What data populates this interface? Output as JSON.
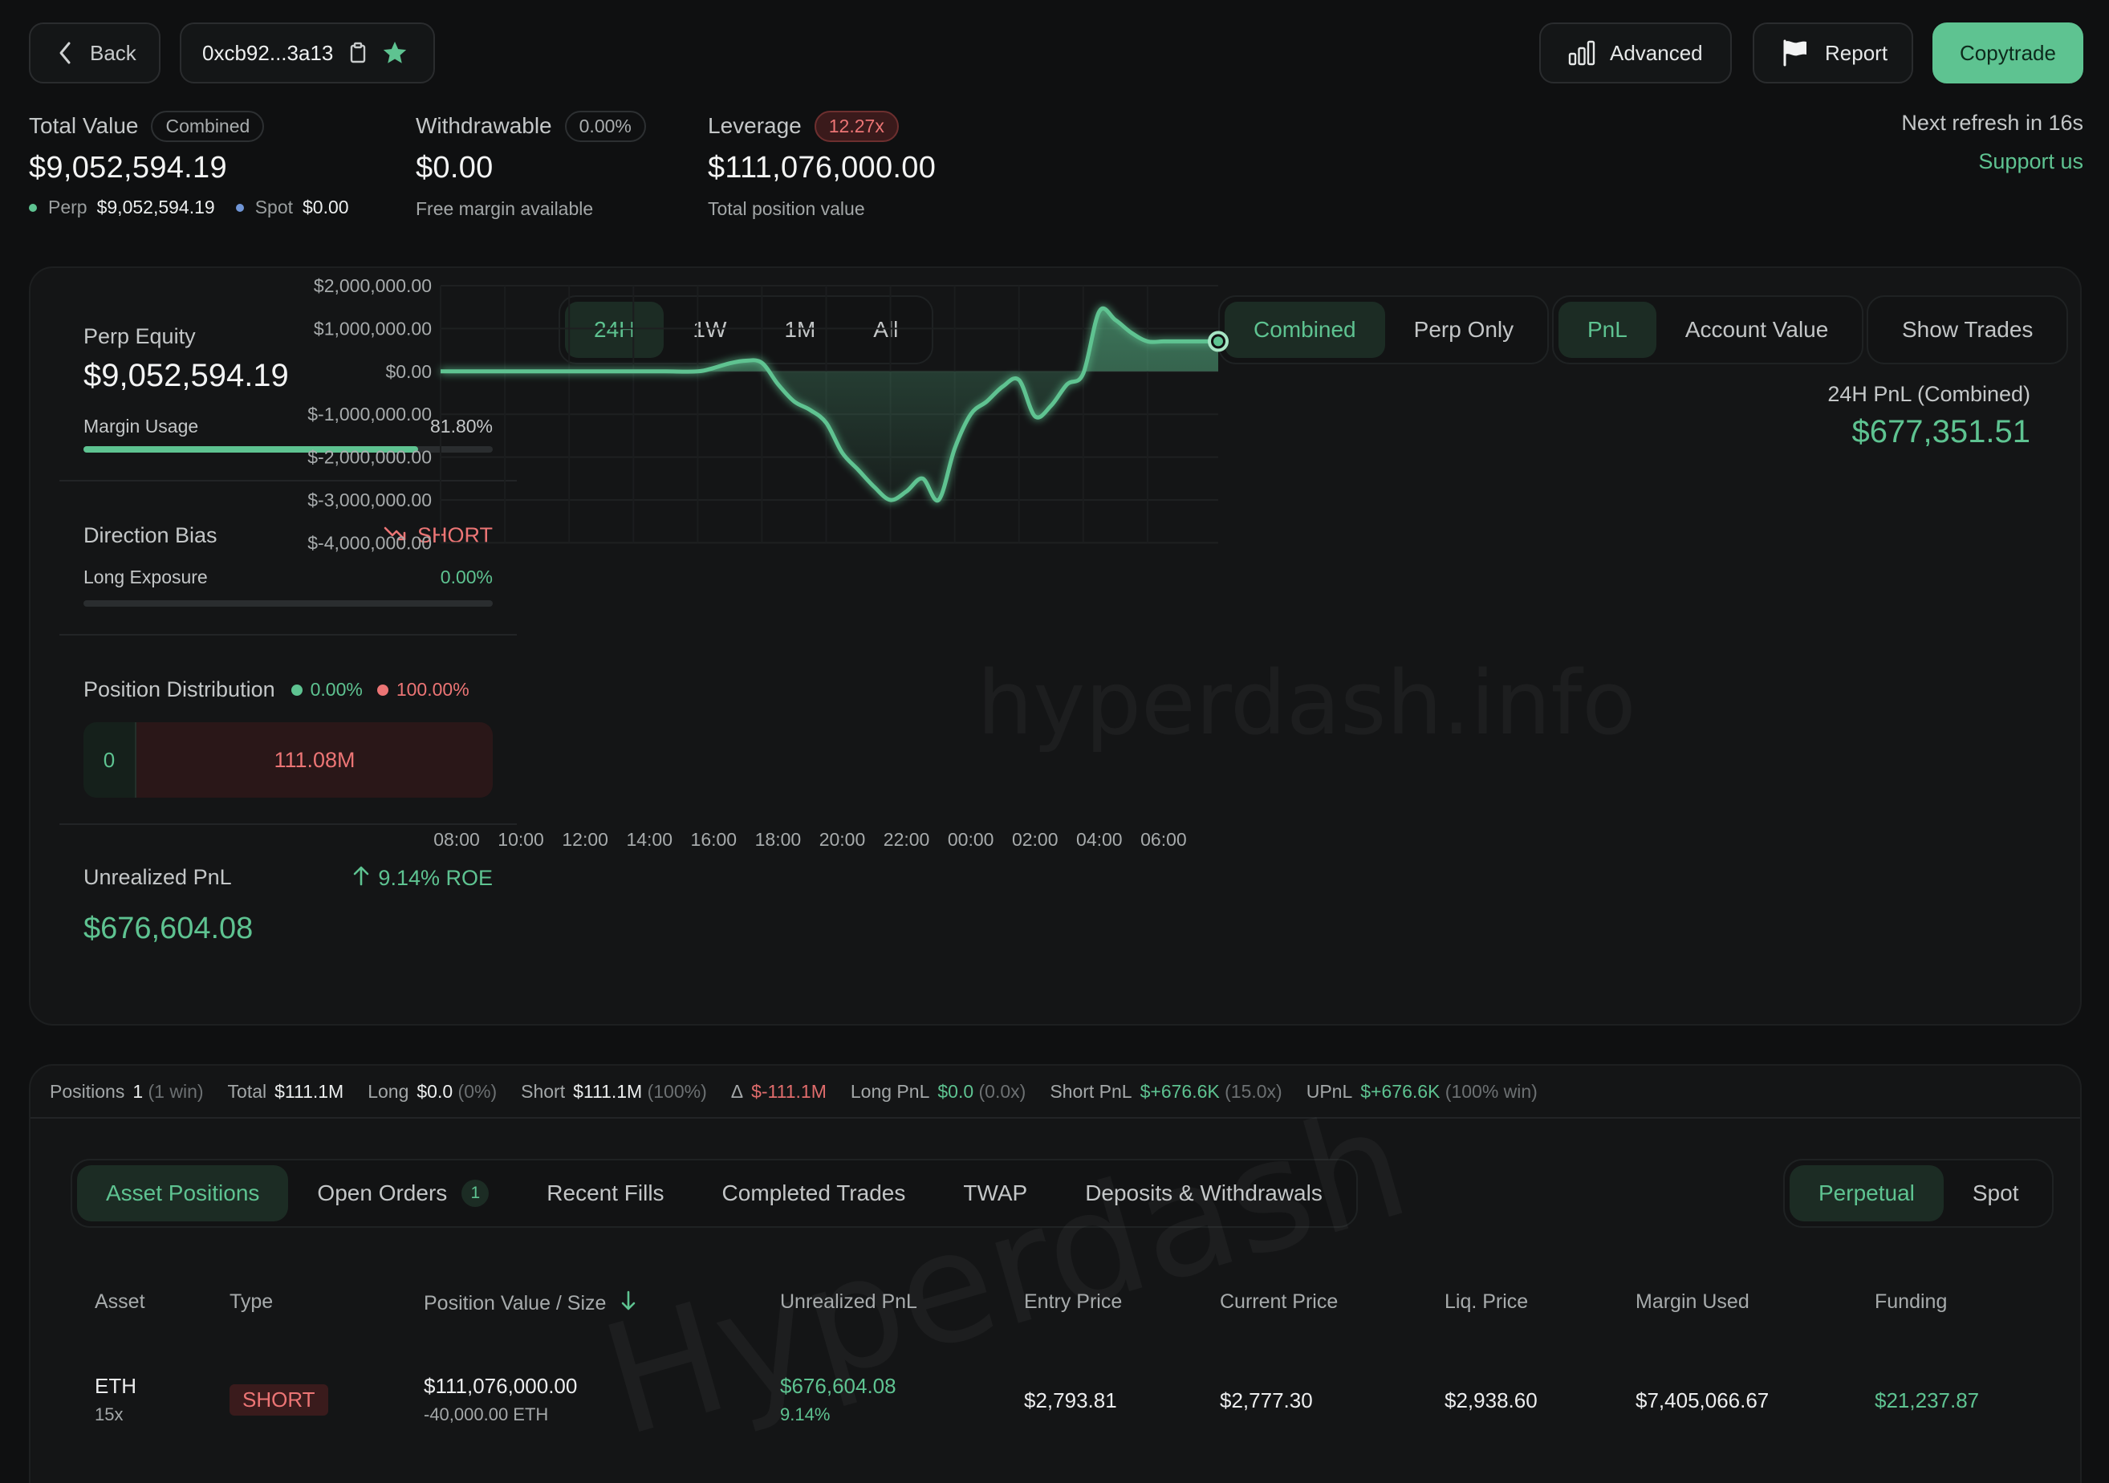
{
  "header": {
    "back_label": "Back",
    "address": "0xcb92...3a13",
    "advanced_label": "Advanced",
    "report_label": "Report",
    "copytrade_label": "Copytrade"
  },
  "stats": {
    "total_value": {
      "label": "Total Value",
      "chip": "Combined",
      "value": "$9,052,594.19",
      "perp_label": "Perp",
      "perp_value": "$9,052,594.19",
      "spot_label": "Spot",
      "spot_value": "$0.00"
    },
    "withdrawable": {
      "label": "Withdrawable",
      "chip": "0.00%",
      "value": "$0.00",
      "sub": "Free margin available"
    },
    "leverage": {
      "label": "Leverage",
      "chip": "12.27x",
      "value": "$111,076,000.00",
      "sub": "Total position value"
    },
    "refresh": "Next refresh in 16s",
    "support": "Support us"
  },
  "left_panel": {
    "perp_equity_label": "Perp Equity",
    "perp_equity_value": "$9,052,594.19",
    "margin_usage_label": "Margin Usage",
    "margin_usage_value": "81.80%",
    "margin_usage_fraction": 0.818,
    "direction_bias_label": "Direction Bias",
    "direction_bias_value": "SHORT",
    "long_exposure_label": "Long Exposure",
    "long_exposure_value": "0.00%",
    "position_distribution_label": "Position Distribution",
    "dist_long_pct": "0.00%",
    "dist_short_pct": "100.00%",
    "dist_long_value": "0",
    "dist_short_value": "111.08M",
    "unrealized_pnl_label": "Unrealized PnL",
    "roe": "9.14% ROE",
    "unrealized_pnl_value": "$676,604.08"
  },
  "chart_controls": {
    "ranges": [
      "24H",
      "1W",
      "1M",
      "All"
    ],
    "active_range": "24H",
    "modes": [
      "Combined",
      "Perp Only"
    ],
    "active_mode": "Combined",
    "metrics": [
      "PnL",
      "Account Value"
    ],
    "active_metric": "PnL",
    "show_trades": "Show Trades",
    "pnl_caption": "24H PnL (Combined)",
    "pnl_value": "$677,351.51"
  },
  "watermark": "hyperdash.info",
  "table_watermark": "Hyperdash",
  "chart_data": {
    "type": "area",
    "title": "",
    "xlabel": "",
    "ylabel": "",
    "x_ticks": [
      "08:00",
      "10:00",
      "12:00",
      "14:00",
      "16:00",
      "18:00",
      "20:00",
      "22:00",
      "00:00",
      "02:00",
      "04:00",
      "06:00"
    ],
    "y_ticks": [
      "$2,000,000.00",
      "$1,000,000.00",
      "$0.00",
      "$-1,000,000.00",
      "$-2,000,000.00",
      "$-3,000,000.00",
      "$-4,000,000.00"
    ],
    "ylim": [
      -4000000,
      2000000
    ],
    "x_hours": [
      0,
      1,
      2,
      3,
      4,
      5,
      6,
      7,
      8,
      8.5,
      9,
      9.5,
      10,
      10.5,
      11,
      11.5,
      12,
      12.5,
      13,
      13.5,
      14,
      14.5,
      15,
      15.5,
      16,
      16.5,
      17,
      17.5,
      18,
      18.5,
      19,
      19.5,
      20,
      20.5,
      21,
      21.5,
      22,
      22.5,
      23,
      23.5,
      24.2
    ],
    "values": [
      0,
      0,
      0,
      0,
      0,
      0,
      0,
      0,
      0,
      80000,
      190000,
      250000,
      200000,
      -300000,
      -700000,
      -900000,
      -1200000,
      -1900000,
      -2300000,
      -2700000,
      -3000000,
      -2800000,
      -2500000,
      -3000000,
      -1800000,
      -1000000,
      -700000,
      -350000,
      -200000,
      -1050000,
      -800000,
      -300000,
      -50000,
      1400000,
      1200000,
      900000,
      700000,
      700000,
      700000,
      700000,
      700000
    ],
    "series": [
      {
        "name": "",
        "color": "#5ec391"
      }
    ]
  },
  "summary": {
    "positions_label": "Positions",
    "positions_value": "1",
    "positions_note": "(1 win)",
    "total_label": "Total",
    "total_value": "$111.1M",
    "long_label": "Long",
    "long_value": "$0.0",
    "long_note": "(0%)",
    "short_label": "Short",
    "short_value": "$111.1M",
    "short_note": "(100%)",
    "delta_label": "Δ",
    "delta_value": "$-111.1M",
    "long_pnl_label": "Long PnL",
    "long_pnl_value": "$0.0",
    "long_pnl_note": "(0.0x)",
    "short_pnl_label": "Short PnL",
    "short_pnl_value": "$+676.6K",
    "short_pnl_note": "(15.0x)",
    "upnl_label": "UPnL",
    "upnl_value": "$+676.6K",
    "upnl_note": "(100% win)"
  },
  "tabs": {
    "items": [
      "Asset Positions",
      "Open Orders",
      "Recent Fills",
      "Completed Trades",
      "TWAP",
      "Deposits & Withdrawals"
    ],
    "active": "Asset Positions",
    "open_orders_count": "1",
    "market_types": [
      "Perpetual",
      "Spot"
    ],
    "active_market": "Perpetual"
  },
  "table": {
    "headers": [
      "Asset",
      "Type",
      "Position Value / Size",
      "Unrealized PnL",
      "Entry Price",
      "Current Price",
      "Liq. Price",
      "Margin Used",
      "Funding"
    ],
    "rows": [
      {
        "asset": "ETH",
        "leverage": "15x",
        "type": "SHORT",
        "position_value": "$111,076,000.00",
        "size": "-40,000.00 ETH",
        "upnl": "$676,604.08",
        "upnl_pct": "9.14%",
        "entry": "$2,793.81",
        "current": "$2,777.30",
        "liq": "$2,938.60",
        "margin": "$7,405,066.67",
        "funding": "$21,237.87"
      }
    ]
  }
}
